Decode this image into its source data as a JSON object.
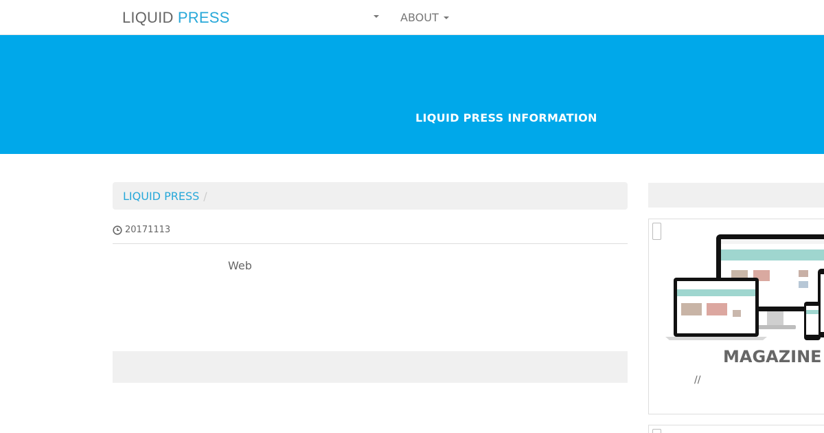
{
  "header": {
    "logo_part1": "LIQUID",
    "logo_part2": "PRESS",
    "nav_about": "ABOUT"
  },
  "banner": {
    "title": "LIQUID PRESS INFORMATION"
  },
  "breadcrumb": {
    "home": "LIQUID PRESS",
    "separator": "/"
  },
  "post": {
    "date": "20171113",
    "body": "Web"
  },
  "sidebar": {
    "card_title": "MAGAZINE",
    "card_sub": "//"
  },
  "colors": {
    "banner": "#00a8ea",
    "accent": "#27a8d9",
    "panel_gray": "#f0f0f0"
  },
  "icons": [
    "chevron-down-icon",
    "clock-icon",
    "devices-image"
  ]
}
